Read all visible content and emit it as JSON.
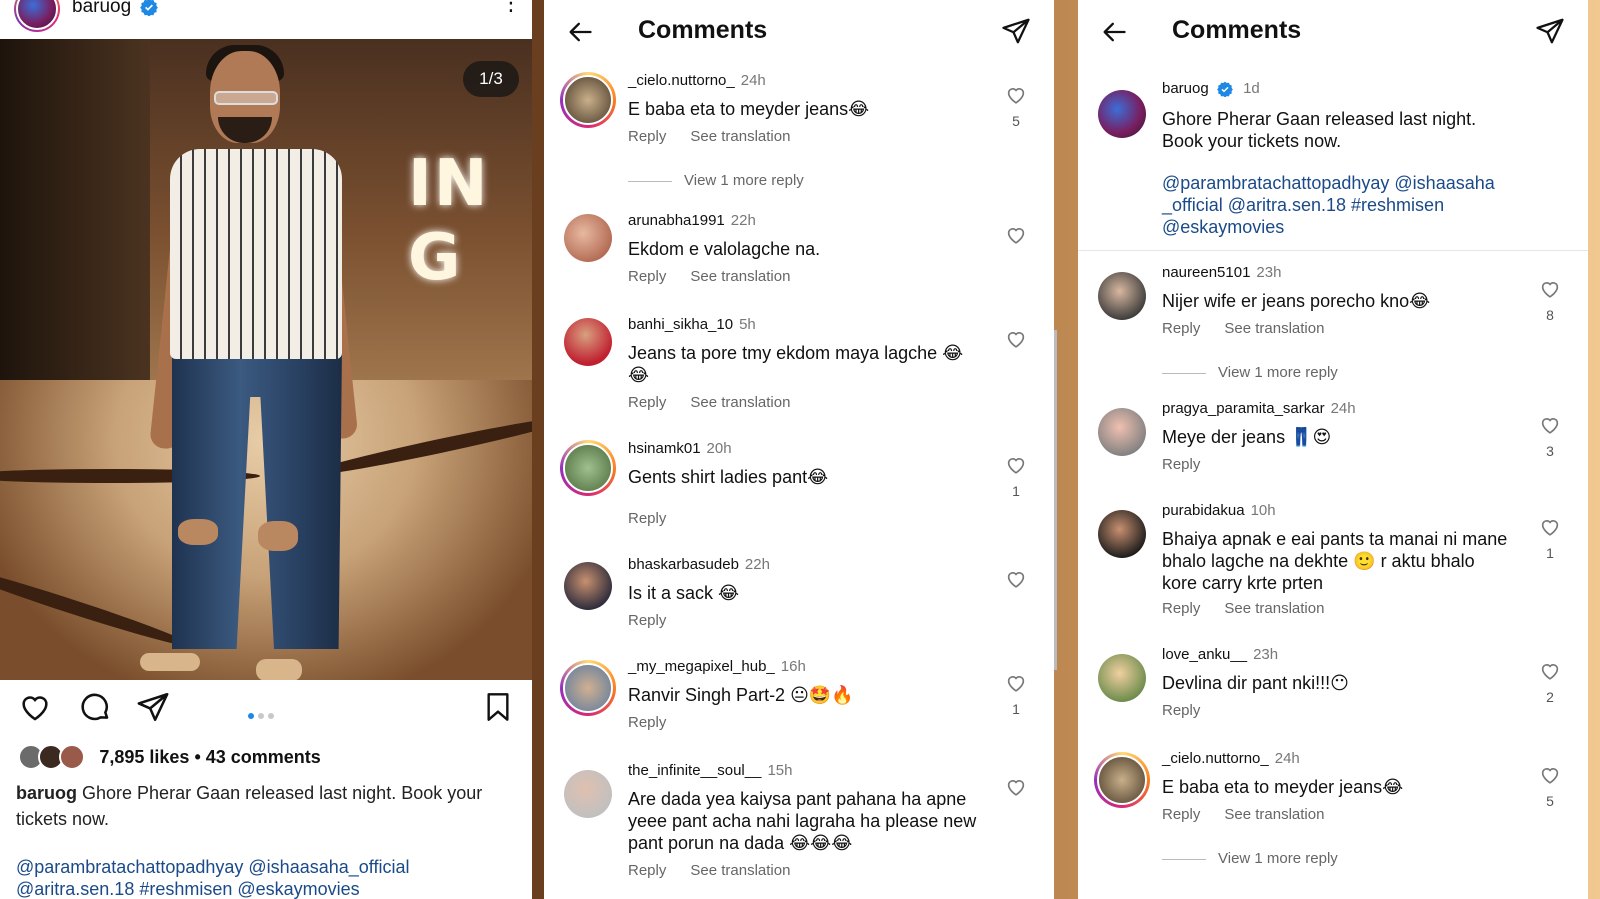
{
  "post": {
    "username": "baruog",
    "counter": "1/3",
    "likes_summary": "7,895 likes • 43 comments",
    "caption_user": "baruog",
    "caption_text": "Ghore Pherar Gaan released last night. Book your tickets now.",
    "mentions_line1": "@parambratachattopadhyay @ishaasaha_official",
    "mentions_line2": "@aritra.sen.18 #reshmisen @eskaymovies",
    "photo_sign": "IN G",
    "colors": {
      "link": "#1a4a8a",
      "dot_active": "#1e88e5"
    }
  },
  "comments_header": {
    "title": "Comments"
  },
  "panel2": {
    "comments": [
      {
        "user": "_cielo.nuttorno_",
        "time": "24h",
        "text": "E baba eta to meyder jeans😂",
        "reply": "Reply",
        "translate": "See translation",
        "likes": "5",
        "more": "View 1 more reply"
      },
      {
        "user": "arunabha1991",
        "time": "22h",
        "text": "Ekdom e valolagche na.",
        "reply": "Reply",
        "translate": "See translation",
        "likes": ""
      },
      {
        "user": "banhi_sikha_10",
        "time": "5h",
        "text": "Jeans ta pore tmy ekdom maya lagche 😂 😂",
        "reply": "Reply",
        "translate": "See translation",
        "likes": ""
      },
      {
        "user": "hsinamk01",
        "time": "20h",
        "text": "Gents shirt ladies pant😂",
        "reply": "Reply",
        "translate": "",
        "likes": "1"
      },
      {
        "user": "bhaskarbasudeb",
        "time": "22h",
        "text": "Is it a sack 😂",
        "reply": "Reply",
        "translate": "",
        "likes": ""
      },
      {
        "user": "_my_megapixel_hub_",
        "time": "16h",
        "text": "Ranvir Singh Part-2 😐🤩🔥",
        "reply": "Reply",
        "translate": "",
        "likes": "1"
      },
      {
        "user": "the_infinite__soul__",
        "time": "15h",
        "text": "Are dada yea kaiysa pant pahana ha apne yeee pant acha nahi lagraha ha please new pant porun na dada 😂😂😂",
        "reply": "Reply",
        "translate": "See translation",
        "likes": ""
      }
    ]
  },
  "panel3": {
    "owner": {
      "user": "baruog",
      "time": "1d",
      "text": "Ghore Pherar Gaan released last night. Book your tickets now.",
      "mentions": "@parambratachattopadhyay @ishaasaha _official @aritra.sen.18 #reshmisen @eskaymovies"
    },
    "comments": [
      {
        "user": "naureen5101",
        "time": "23h",
        "text": "Nijer wife er jeans porecho kno😂",
        "reply": "Reply",
        "translate": "See translation",
        "likes": "8",
        "more": "View 1 more reply"
      },
      {
        "user": "pragya_paramita_sarkar",
        "time": "24h",
        "text": "Meye der  jeans 👖😍",
        "reply": "Reply",
        "translate": "",
        "likes": "3"
      },
      {
        "user": "purabidakua",
        "time": "10h",
        "text": "Bhaiya apnak e eai pants ta manai ni mane bhalo lagche na dekhte 🙂 r aktu bhalo kore carry krte prten",
        "reply": "Reply",
        "translate": "See translation",
        "likes": "1"
      },
      {
        "user": "love_anku__",
        "time": "23h",
        "text": "Devlina dir pant nki!!!😶",
        "reply": "Reply",
        "translate": "",
        "likes": "2"
      },
      {
        "user": "_cielo.nuttorno_",
        "time": "24h",
        "text": "E baba eta to meyder jeans😂",
        "reply": "Reply",
        "translate": "See translation",
        "likes": "5",
        "more": "View 1 more reply"
      }
    ]
  }
}
